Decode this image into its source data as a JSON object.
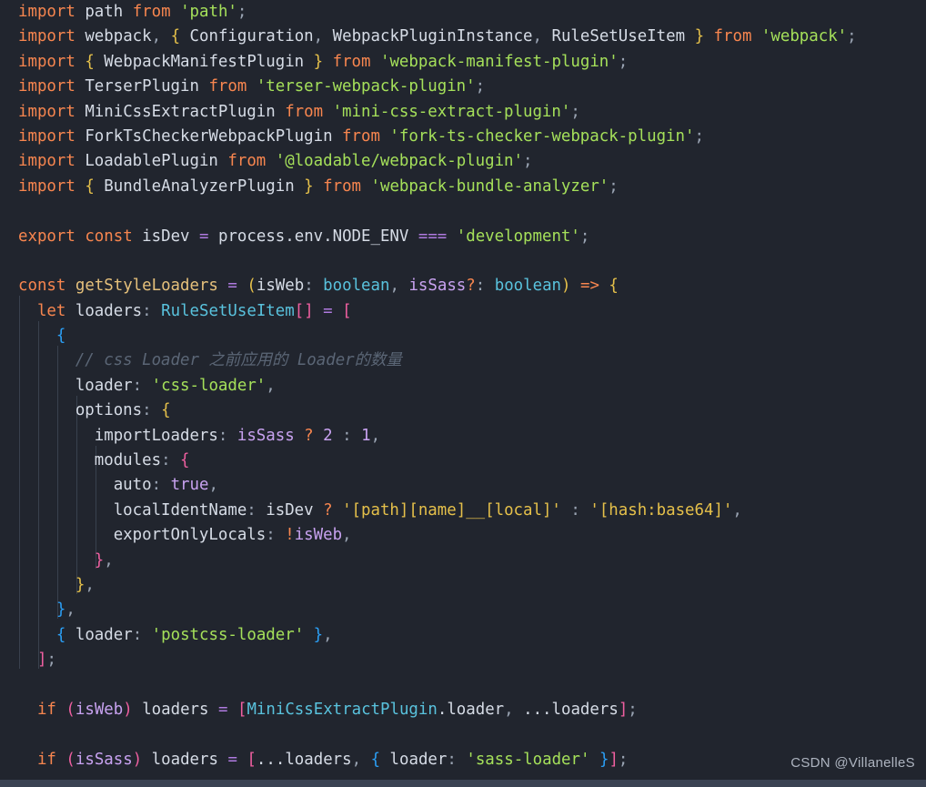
{
  "editor": {
    "background": "#21252e",
    "font_size_px": 17.4,
    "line_height_px": 27.4,
    "language": "TypeScript",
    "file_kind": "webpack config"
  },
  "theme": {
    "keyword": "#f8864f",
    "identifier": "#d6dce6",
    "type": "#59c2dd",
    "function": "#e5c07b",
    "string": "#a5e05a",
    "number": "#c8a2f0",
    "variable": "#c8a2f0",
    "operator": "#b07ae0",
    "punctuation": "#9aa4b3",
    "comment": "#5b6676",
    "bracket_level_1": "#ef5fa0",
    "bracket_level_2": "#e5c04a",
    "bracket_level_3": "#2b9ff5",
    "indent_guide": "#39414e",
    "bottom_bar": "#3a4252"
  },
  "watermark": {
    "text": "CSDN @VillanelleS"
  },
  "code": {
    "plain_text": [
      "import path from 'path';",
      "import webpack, { Configuration, WebpackPluginInstance, RuleSetUseItem } from 'webpack';",
      "import { WebpackManifestPlugin } from 'webpack-manifest-plugin';",
      "import TerserPlugin from 'terser-webpack-plugin';",
      "import MiniCssExtractPlugin from 'mini-css-extract-plugin';",
      "import ForkTsCheckerWebpackPlugin from 'fork-ts-checker-webpack-plugin';",
      "import LoadablePlugin from '@loadable/webpack-plugin';",
      "import { BundleAnalyzerPlugin } from 'webpack-bundle-analyzer';",
      "",
      "export const isDev = process.env.NODE_ENV === 'development';",
      "",
      "const getStyleLoaders = (isWeb: boolean, isSass?: boolean) => {",
      "  let loaders: RuleSetUseItem[] = [",
      "    {",
      "      // css Loader 之前应用的 Loader的数量",
      "      loader: 'css-loader',",
      "      options: {",
      "        importLoaders: isSass ? 2 : 1,",
      "        modules: {",
      "          auto: true,",
      "          localIdentName: isDev ? '[path][name]__[local]' : '[hash:base64]',",
      "          exportOnlyLocals: !isWeb,",
      "        },",
      "      },",
      "    },",
      "    { loader: 'postcss-loader' },",
      "  ];",
      "",
      "  if (isWeb) loaders = [MiniCssExtractPlugin.loader, ...loaders];",
      "",
      "  if (isSass) loaders = [...loaders, { loader: 'sass-loader' }];"
    ],
    "tokens": {
      "l1": {
        "kw_import": "import",
        "mod": "path",
        "kw_from": "from",
        "str": "'path'",
        "semi": ";"
      },
      "l2": {
        "kw_import": "import",
        "default": "webpack",
        "comma": ",",
        "named": [
          "Configuration",
          "WebpackPluginInstance",
          "RuleSetUseItem"
        ],
        "kw_from": "from",
        "str": "'webpack'",
        "semi": ";"
      },
      "l3": {
        "kw_import": "import",
        "named": "WebpackManifestPlugin",
        "kw_from": "from",
        "str": "'webpack-manifest-plugin'",
        "semi": ";"
      },
      "l4": {
        "kw_import": "import",
        "default": "TerserPlugin",
        "kw_from": "from",
        "str": "'terser-webpack-plugin'",
        "semi": ";"
      },
      "l5": {
        "kw_import": "import",
        "default": "MiniCssExtractPlugin",
        "kw_from": "from",
        "str": "'mini-css-extract-plugin'",
        "semi": ";"
      },
      "l6": {
        "kw_import": "import",
        "default": "ForkTsCheckerWebpackPlugin",
        "kw_from": "from",
        "str": "'fork-ts-checker-webpack-plugin'",
        "semi": ";"
      },
      "l7": {
        "kw_import": "import",
        "default": "LoadablePlugin",
        "kw_from": "from",
        "str": "'@loadable/webpack-plugin'",
        "semi": ";"
      },
      "l8": {
        "kw_import": "import",
        "named": "BundleAnalyzerPlugin",
        "kw_from": "from",
        "str": "'webpack-bundle-analyzer'",
        "semi": ";"
      },
      "l10": {
        "kw_export": "export",
        "kw_const": "const",
        "name": "isDev",
        "eq": "=",
        "expr": "process.env.NODE_ENV",
        "cmp": "===",
        "str": "'development'",
        "semi": ";"
      },
      "l12": {
        "kw_const": "const",
        "fn": "getStyleLoaders",
        "eq": "=",
        "p1": "isWeb",
        "t1": "boolean",
        "p2": "isSass",
        "opt": "?",
        "t2": "boolean",
        "arrow": "=>"
      },
      "l13": {
        "kw_let": "let",
        "name": "loaders",
        "type": "RuleSetUseItem",
        "arr": "[]",
        "eq": "="
      },
      "l15": {
        "comment": "// css Loader 之前应用的 Loader的数量"
      },
      "l16": {
        "key": "loader",
        "str": "'css-loader'"
      },
      "l17": {
        "key": "options"
      },
      "l18": {
        "key": "importLoaders",
        "cond": "isSass",
        "q": "?",
        "a": "2",
        "colon": ":",
        "b": "1"
      },
      "l19": {
        "key": "modules"
      },
      "l20": {
        "key": "auto",
        "val": "true"
      },
      "l21": {
        "key": "localIdentName",
        "cond": "isDev",
        "q": "?",
        "a": "'[path][name]__[local]'",
        "colon": ":",
        "b": "'[hash:base64]'"
      },
      "l22": {
        "key": "exportOnlyLocals",
        "bang": "!",
        "val": "isWeb"
      },
      "l27": {
        "key": "loader",
        "str": "'postcss-loader'"
      },
      "l30": {
        "kw_if": "if",
        "cond": "isWeb",
        "name": "loaders",
        "eq": "=",
        "cls": "MiniCssExtractPlugin",
        "prop": ".loader",
        "spread": "...loaders",
        "semi": ";"
      },
      "l32": {
        "kw_if": "if",
        "cond": "isSass",
        "name": "loaders",
        "eq": "=",
        "spread": "...loaders",
        "key": "loader",
        "str": "'sass-loader'",
        "semi": ";"
      }
    }
  }
}
